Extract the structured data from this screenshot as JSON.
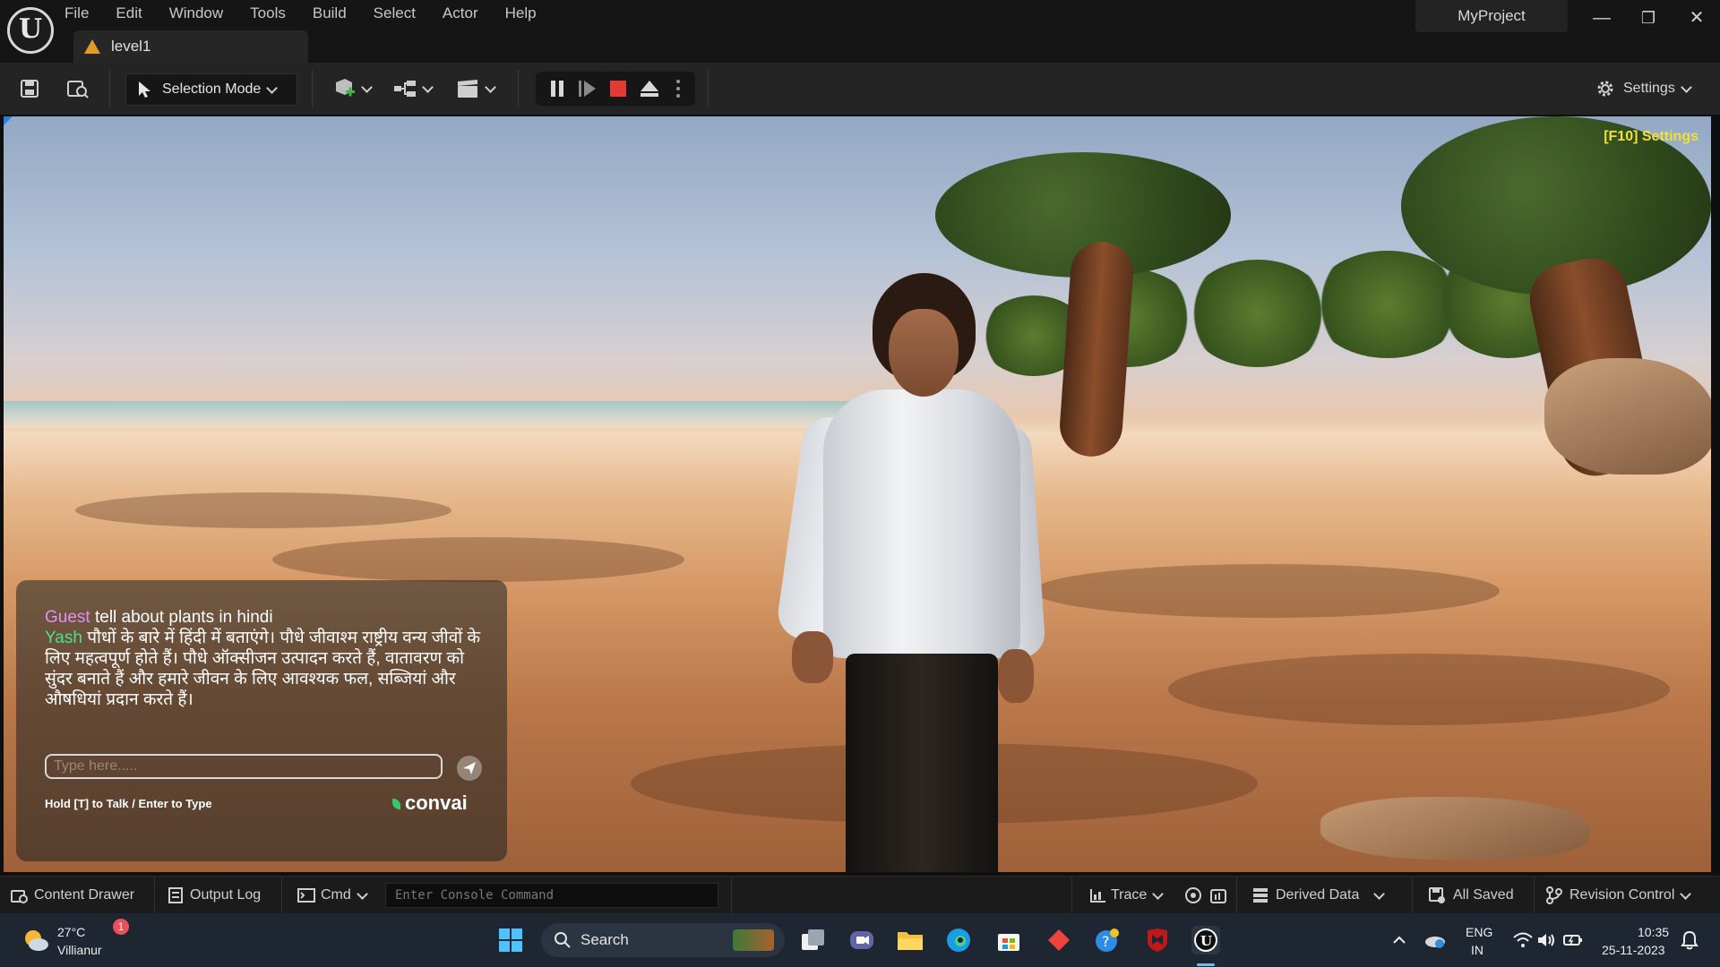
{
  "app": {
    "logo_letter": "U",
    "project_name": "MyProject",
    "menu": [
      "File",
      "Edit",
      "Window",
      "Tools",
      "Build",
      "Select",
      "Actor",
      "Help"
    ],
    "level_tab": "level1",
    "window_controls": {
      "minimize": "—",
      "restore": "❐",
      "close": "✕"
    }
  },
  "toolbar": {
    "selection_mode": "Selection Mode",
    "settings": "Settings",
    "icons": [
      "save-icon",
      "browse-icon",
      "add-actor-icon",
      "blueprint-icon",
      "cinematics-icon",
      "pause-icon",
      "skip-frame-icon",
      "stop-icon",
      "eject-icon",
      "more-options-icon",
      "settings-gear-icon"
    ]
  },
  "viewport": {
    "overlay_settings": "[F10] Settings",
    "chat": {
      "guest_name": "Guest",
      "guest_message": "tell about plants in hindi",
      "npc_name": "Yash",
      "npc_message": "पौधों के बारे में हिंदी में बताएंगे। पौधे जीवाश्म राष्ट्रीय वन्य जीवों के लिए महत्वपूर्ण होते हैं। पौधे ऑक्सीजन उत्पादन करते हैं, वातावरण को सुंदर बनाते हैं और हमारे जीवन के लिए आवश्यक फल, सब्जियां और औषधियां प्रदान करते हैं।",
      "input_placeholder": "Type here.....",
      "hint": "Hold [T] to Talk / Enter to Type",
      "brand": "convai"
    }
  },
  "statusbar": {
    "content_drawer": "Content Drawer",
    "output_log": "Output Log",
    "cmd": "Cmd",
    "console_placeholder": "Enter Console Command",
    "trace": "Trace",
    "derived_data": "Derived Data",
    "all_saved": "All Saved",
    "revision_control": "Revision Control"
  },
  "taskbar": {
    "weather_temp": "27°C",
    "weather_location": "Villianur",
    "weather_badge": "1",
    "search_label": "Search",
    "language_top": "ENG",
    "language_bottom": "IN",
    "time": "10:35",
    "date": "25-11-2023"
  },
  "colors": {
    "accent_blue": "#2b7de0",
    "stop_red": "#e53935",
    "guest_name": "#e38ff0",
    "npc_name": "#49e08e",
    "overlay_yellow": "#f3e034"
  }
}
